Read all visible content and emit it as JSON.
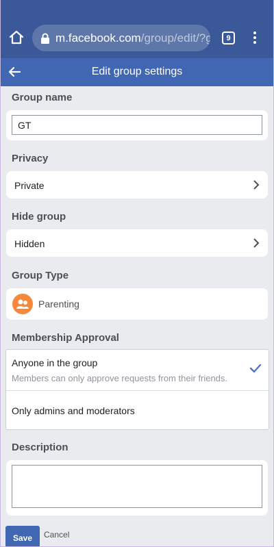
{
  "browser": {
    "url_host": "m.facebook.com",
    "url_path": "/group/edit/?g",
    "tab_count": "9"
  },
  "header": {
    "title": "Edit group settings"
  },
  "group_name": {
    "label": "Group name",
    "value": "GT"
  },
  "privacy": {
    "label": "Privacy",
    "value": "Private"
  },
  "hide_group": {
    "label": "Hide group",
    "value": "Hidden"
  },
  "group_type": {
    "label": "Group Type",
    "value": "Parenting",
    "icon": "people-icon",
    "icon_color": "#f5883b"
  },
  "membership_approval": {
    "label": "Membership Approval",
    "options": [
      {
        "title": "Anyone in the group",
        "subtitle": "Members can only approve requests from their friends.",
        "selected": true
      },
      {
        "title": "Only admins and moderators",
        "selected": false
      }
    ]
  },
  "description": {
    "label": "Description",
    "value": ""
  },
  "actions": {
    "save_label": "Save",
    "cancel_label": "Cancel"
  },
  "colors": {
    "brand_dark": "#3b5998",
    "brand": "#4267b2",
    "check": "#4a76c5"
  }
}
